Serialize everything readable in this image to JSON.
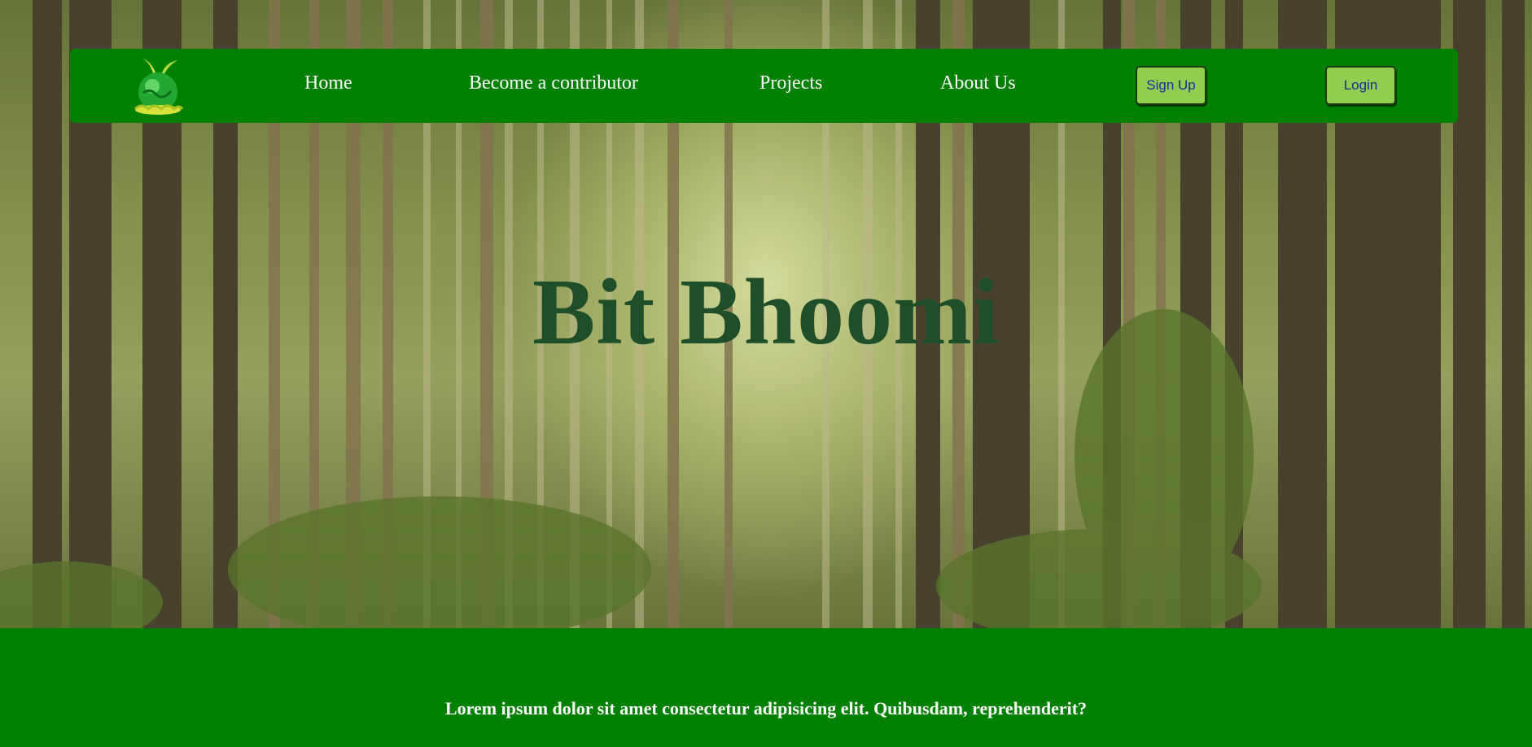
{
  "site": {
    "logo_icon": "globe-plant-logo-icon"
  },
  "nav": {
    "home": "Home",
    "contributor": "Become a contributor",
    "projects": "Projects",
    "about": "About Us",
    "signup": "Sign Up",
    "login": "Login"
  },
  "hero": {
    "title": "Bit Bhoomi"
  },
  "footer": {
    "text": "Lorem ipsum dolor sit amet consectetur adipisicing elit. Quibusdam, reprehenderit?"
  },
  "colors": {
    "nav_bg": "#008000",
    "button_bg": "#8fce4f",
    "button_text": "#1c2a9c",
    "title": "#1f4f2a"
  }
}
